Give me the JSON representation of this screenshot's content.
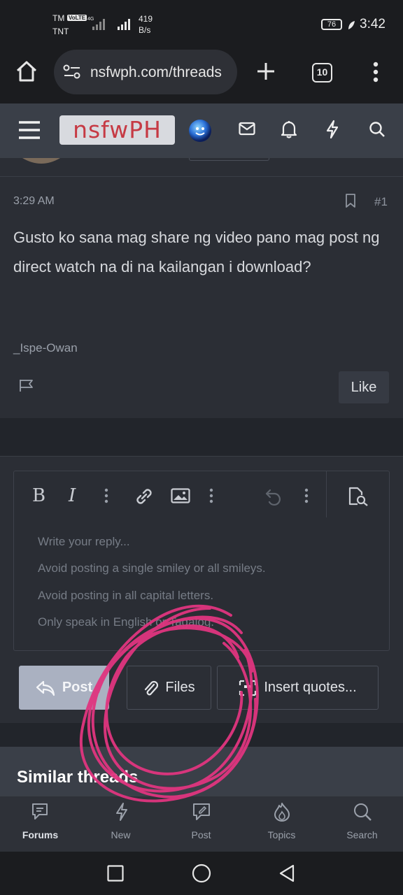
{
  "status_bar": {
    "carrier_top": "TM",
    "volte": "VoLTE",
    "carrier_bottom": "TNT",
    "network_type": "4G",
    "speed_value": "419",
    "speed_unit": "B/s",
    "battery": "76",
    "time": "3:42"
  },
  "browser": {
    "url": "nsfwph.com/threads",
    "tab_count": "10",
    "icons": [
      "home-icon",
      "site-settings-icon",
      "new-tab-icon",
      "tab-switcher-icon",
      "more-menu-icon"
    ]
  },
  "site_header": {
    "logo_text": "nsfwPH",
    "icons": [
      "menu-icon",
      "avatar-globe",
      "mail-icon",
      "bell-icon",
      "lightning-icon",
      "search-icon"
    ]
  },
  "post": {
    "time": "3:29 AM",
    "number": "#1",
    "body": "Gusto ko sana mag share ng video pano mag post ng direct watch na di na kailangan i download?",
    "signature": "_Ispe-Owan",
    "like_label": "Like"
  },
  "editor": {
    "toolbar_icons": [
      "bold-icon",
      "italic-icon",
      "more-options-icon",
      "link-icon",
      "image-icon",
      "more-options-icon",
      "undo-icon",
      "more-options-icon",
      "preview-icon"
    ],
    "placeholder_lines": [
      "Write your reply...",
      "Avoid posting a single smiley or all smileys.",
      "Avoid posting in all capital letters.",
      "Only speak in English or Tagalog."
    ],
    "post_label": "Post",
    "files_label": "Files",
    "quotes_label": "Insert quotes..."
  },
  "similar": {
    "title": "Similar threads"
  },
  "bottom_nav": [
    {
      "label": "Forums",
      "icon": "forums-icon",
      "active": true
    },
    {
      "label": "New",
      "icon": "lightning-icon",
      "active": false
    },
    {
      "label": "Post",
      "icon": "post-icon",
      "active": false
    },
    {
      "label": "Topics",
      "icon": "topics-icon",
      "active": false
    },
    {
      "label": "Search",
      "icon": "search-icon",
      "active": false
    }
  ],
  "colors": {
    "accent_scribble": "#e0357f",
    "logo_text": "#c63a44",
    "post_button": "#aab1c1"
  }
}
